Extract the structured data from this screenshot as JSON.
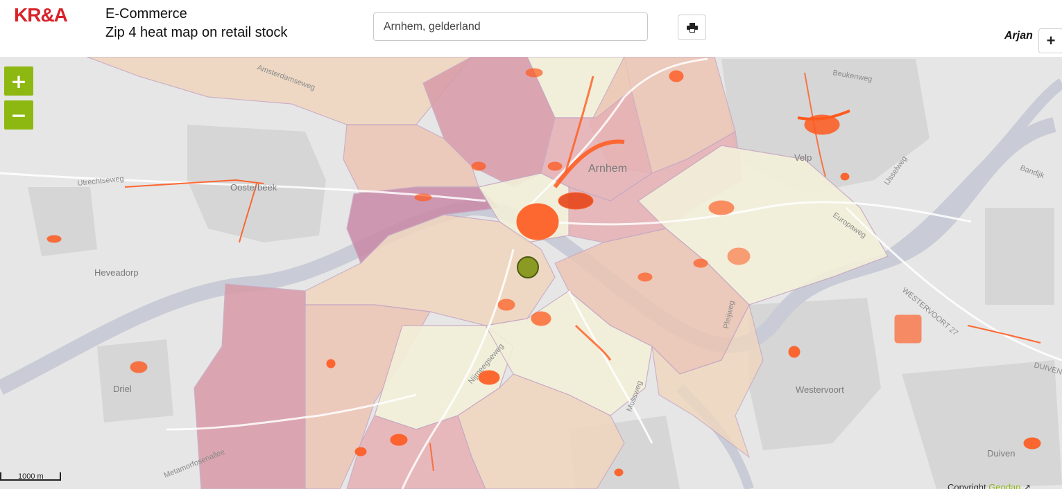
{
  "header": {
    "logo_text": "KR&A",
    "title_line1": "E-Commerce",
    "title_line2": "Zip 4 heat map on retail stock",
    "search_value": "Arnhem, gelderland",
    "print_icon": "print-icon",
    "user_name": "Arjan",
    "user_add_label": "+"
  },
  "map": {
    "zoom_in_label": "+",
    "zoom_out_label": "−",
    "scale_label": "1000 m",
    "copyright_prefix": "Copyright ",
    "copyright_brand": "Geodan",
    "places": {
      "arnhem": "Arnhem",
      "oosterbeek": "Oosterbeek",
      "heveadorp": "Heveadorp",
      "driel": "Driel",
      "velp": "Velp",
      "westervoort": "Westervoort",
      "duiven": "Duiven"
    },
    "streets": {
      "utrechtseweg": "Utrechtseweg",
      "beukenweg": "Beukenweg",
      "ijsselweg": "IJsselweg",
      "europaweg": "Europaweg",
      "westervoort27": "WESTERVOORT 27",
      "nijmeegseweg": "Nijmeegseweg",
      "metamorfosenallee": "Metamorfosenallee",
      "pleijweg": "Pleijweg",
      "mossweg": "Mossweg",
      "bandijk": "Bandijk",
      "amsterdamseweg": "Amsterdamseweg",
      "duiven_road": "DUIVEN"
    },
    "accent_color": "#8db812",
    "heat_colors": [
      "#f3f0d9",
      "#f0d6be",
      "#ecc5b4",
      "#e6b1b4",
      "#d89aa7",
      "#c98aa8"
    ],
    "retail_color": "#ff5a1f"
  }
}
